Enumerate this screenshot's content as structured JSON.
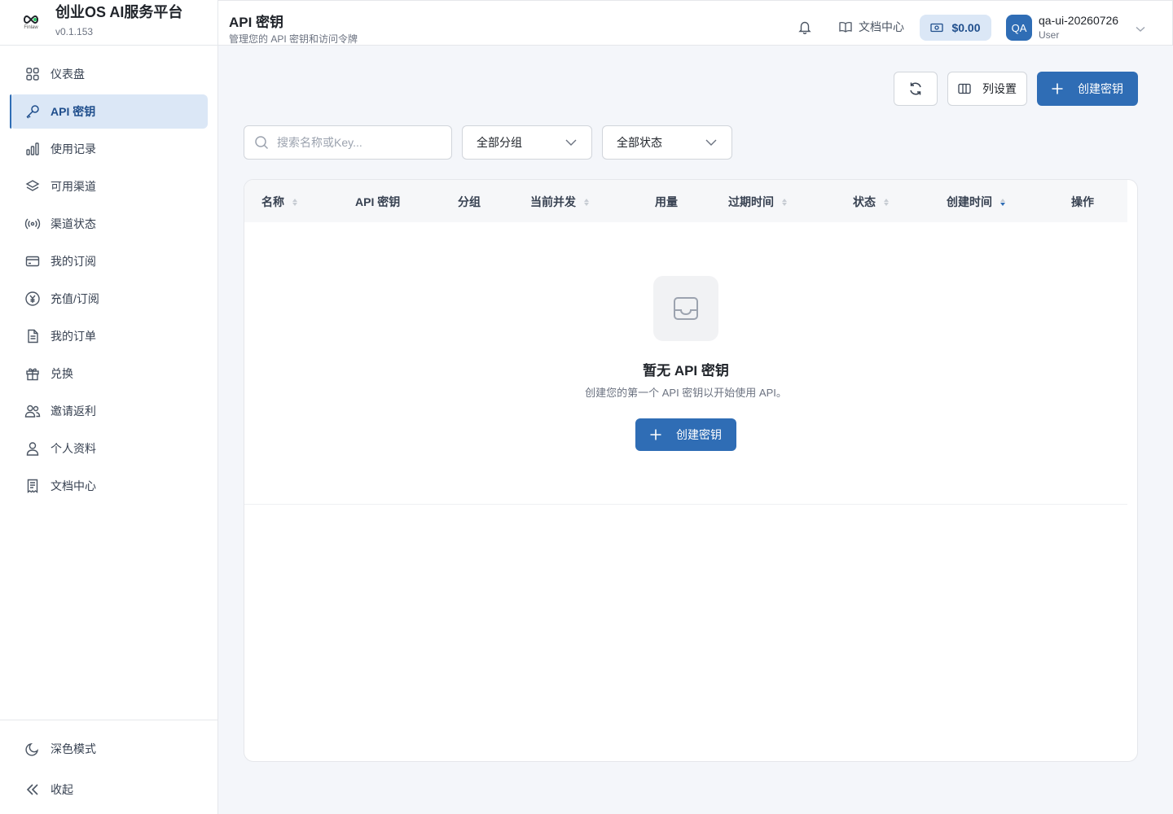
{
  "brand": {
    "title": "创业OS AI服务平台",
    "version": "v0.1.153",
    "logo_text": "Finlaw"
  },
  "sidebar": {
    "items": [
      {
        "label": "仪表盘",
        "icon": "grid-icon"
      },
      {
        "label": "API 密钥",
        "icon": "key-icon",
        "active": true
      },
      {
        "label": "使用记录",
        "icon": "bar-chart-icon"
      },
      {
        "label": "可用渠道",
        "icon": "layers-icon"
      },
      {
        "label": "渠道状态",
        "icon": "broadcast-icon"
      },
      {
        "label": "我的订阅",
        "icon": "credit-card-icon"
      },
      {
        "label": "充值/订阅",
        "icon": "yen-circle-icon"
      },
      {
        "label": "我的订单",
        "icon": "document-icon"
      },
      {
        "label": "兑换",
        "icon": "gift-icon"
      },
      {
        "label": "邀请返利",
        "icon": "users-icon"
      },
      {
        "label": "个人资料",
        "icon": "user-icon"
      },
      {
        "label": "文档中心",
        "icon": "receipt-icon"
      }
    ],
    "footer": {
      "dark_mode": "深色模式",
      "collapse": "收起"
    }
  },
  "header": {
    "title": "API 密钥",
    "subtitle": "管理您的 API 密钥和访问令牌",
    "docs_link": "文档中心",
    "balance": "$0.00",
    "avatar_initials": "QA",
    "user_name": "qa-ui-20260726",
    "user_role": "User"
  },
  "toolbar": {
    "columns_label": "列设置",
    "create_label": "创建密钥"
  },
  "filters": {
    "search_placeholder": "搜索名称或Key...",
    "group_select": "全部分组",
    "status_select": "全部状态"
  },
  "table": {
    "columns": [
      "名称",
      "API 密钥",
      "分组",
      "当前并发",
      "用量",
      "过期时间",
      "状态",
      "创建时间",
      "操作"
    ]
  },
  "empty_state": {
    "title": "暂无 API 密钥",
    "description": "创建您的第一个 API 密钥以开始使用 API。",
    "button": "创建密钥"
  },
  "colors": {
    "primary": "#2f6db5",
    "active_bg": "#dbe7f6",
    "page_bg": "#f4f6fa"
  }
}
